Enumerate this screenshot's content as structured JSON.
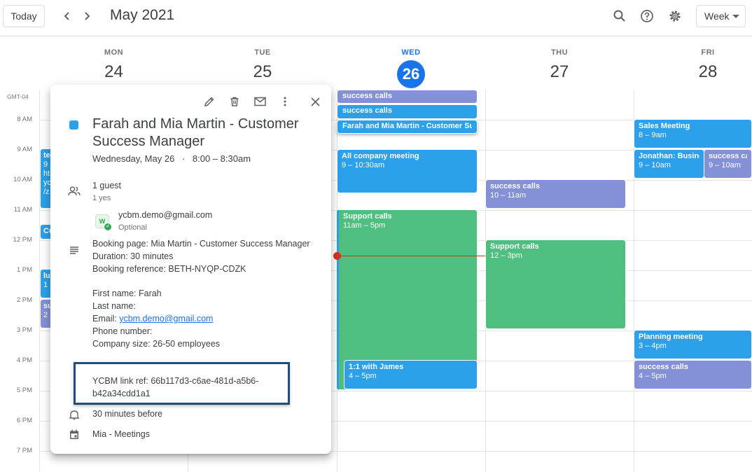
{
  "header": {
    "today_label": "Today",
    "month_title": "May 2021",
    "view_label": "Week",
    "icons": [
      "chevron-left-icon",
      "chevron-right-icon",
      "search-icon",
      "help-icon",
      "gear-icon",
      "caret-down-icon"
    ]
  },
  "days": [
    {
      "name": "MON",
      "num": "24"
    },
    {
      "name": "TUE",
      "num": "25"
    },
    {
      "name": "WED",
      "num": "26"
    },
    {
      "name": "THU",
      "num": "27"
    },
    {
      "name": "FRI",
      "num": "28"
    }
  ],
  "timezone": "GMT-04",
  "times": [
    "8 AM",
    "9 AM",
    "10 AM",
    "11 AM",
    "12 PM",
    "1 PM",
    "2 PM",
    "3 PM",
    "4 PM",
    "5 PM",
    "6 PM",
    "7 PM"
  ],
  "events": {
    "wed_success1": {
      "title": "success calls"
    },
    "wed_success2": {
      "title": "success calls"
    },
    "wed_farah": {
      "title": "Farah and Mia Martin - Customer Success Manager"
    },
    "wed_allco": {
      "title": "All company meeting",
      "time": "9 – 10:30am"
    },
    "wed_support": {
      "title": "Support calls",
      "time": "11am – 5pm"
    },
    "wed_james": {
      "title": "1:1 with James",
      "time": "4 – 5pm"
    },
    "thu_success": {
      "title": "success calls",
      "time": "10 – 11am"
    },
    "thu_support": {
      "title": "Support calls",
      "time": "12 – 3pm"
    },
    "fri_sales": {
      "title": "Sales Meeting",
      "time": "8 – 9am"
    },
    "fri_jonathan": {
      "title": "Jonathan: Business",
      "time": "9 – 10am"
    },
    "fri_success1": {
      "title": "success calls",
      "time": "9 – 10am"
    },
    "fri_planning": {
      "title": "Planning meeting",
      "time": "3 – 4pm"
    },
    "fri_success2": {
      "title": "success calls",
      "time": "4 – 5pm"
    },
    "mon_ev1": {
      "title": "te",
      "lines": [
        "9",
        "ht",
        "yo",
        "/z"
      ]
    },
    "mon_ev2": {
      "title": "Cu"
    },
    "mon_ev3": {
      "title": "lu",
      "time": "1"
    },
    "mon_ev4": {
      "title": "su",
      "time": "2"
    }
  },
  "popup": {
    "title": "Farah and Mia Martin - Customer Success Manager",
    "when_date": "Wednesday, May 26",
    "when_sep": "·",
    "when_time": "8:00 – 8:30am",
    "guests": "1 guest",
    "guests_sub": "1 yes",
    "guest_email": "ycbm.demo@gmail.com",
    "guest_role": "Optional",
    "avatar_initial": "W",
    "desc": {
      "booking_page": "Booking page: Mia Martin - Customer Success Manager",
      "duration": "Duration: 30 minutes",
      "reference": "Booking reference: BETH-NYQP-CDZK",
      "first_name": "First name: Farah",
      "last_name": "Last name:",
      "email_label": "Email: ",
      "email_link": "ycbm.demo@gmail.com",
      "phone": "Phone number:",
      "company": "Company size: 26-50 employees",
      "link_ref_1": "YCBM link ref: 66b117d3-c6ae-481d-a5b6-",
      "link_ref_2": "b42a34cdd1a1"
    },
    "reminder": "30 minutes before",
    "calendar": "Mia - Meetings"
  },
  "colors": {
    "blue_event": "#2ca0ea",
    "purple_event": "#8591d6",
    "green_event": "#4fbf7f",
    "today_accent": "#1a73e8",
    "now_line": "#d93025",
    "highlight_border": "#1f4e79"
  }
}
